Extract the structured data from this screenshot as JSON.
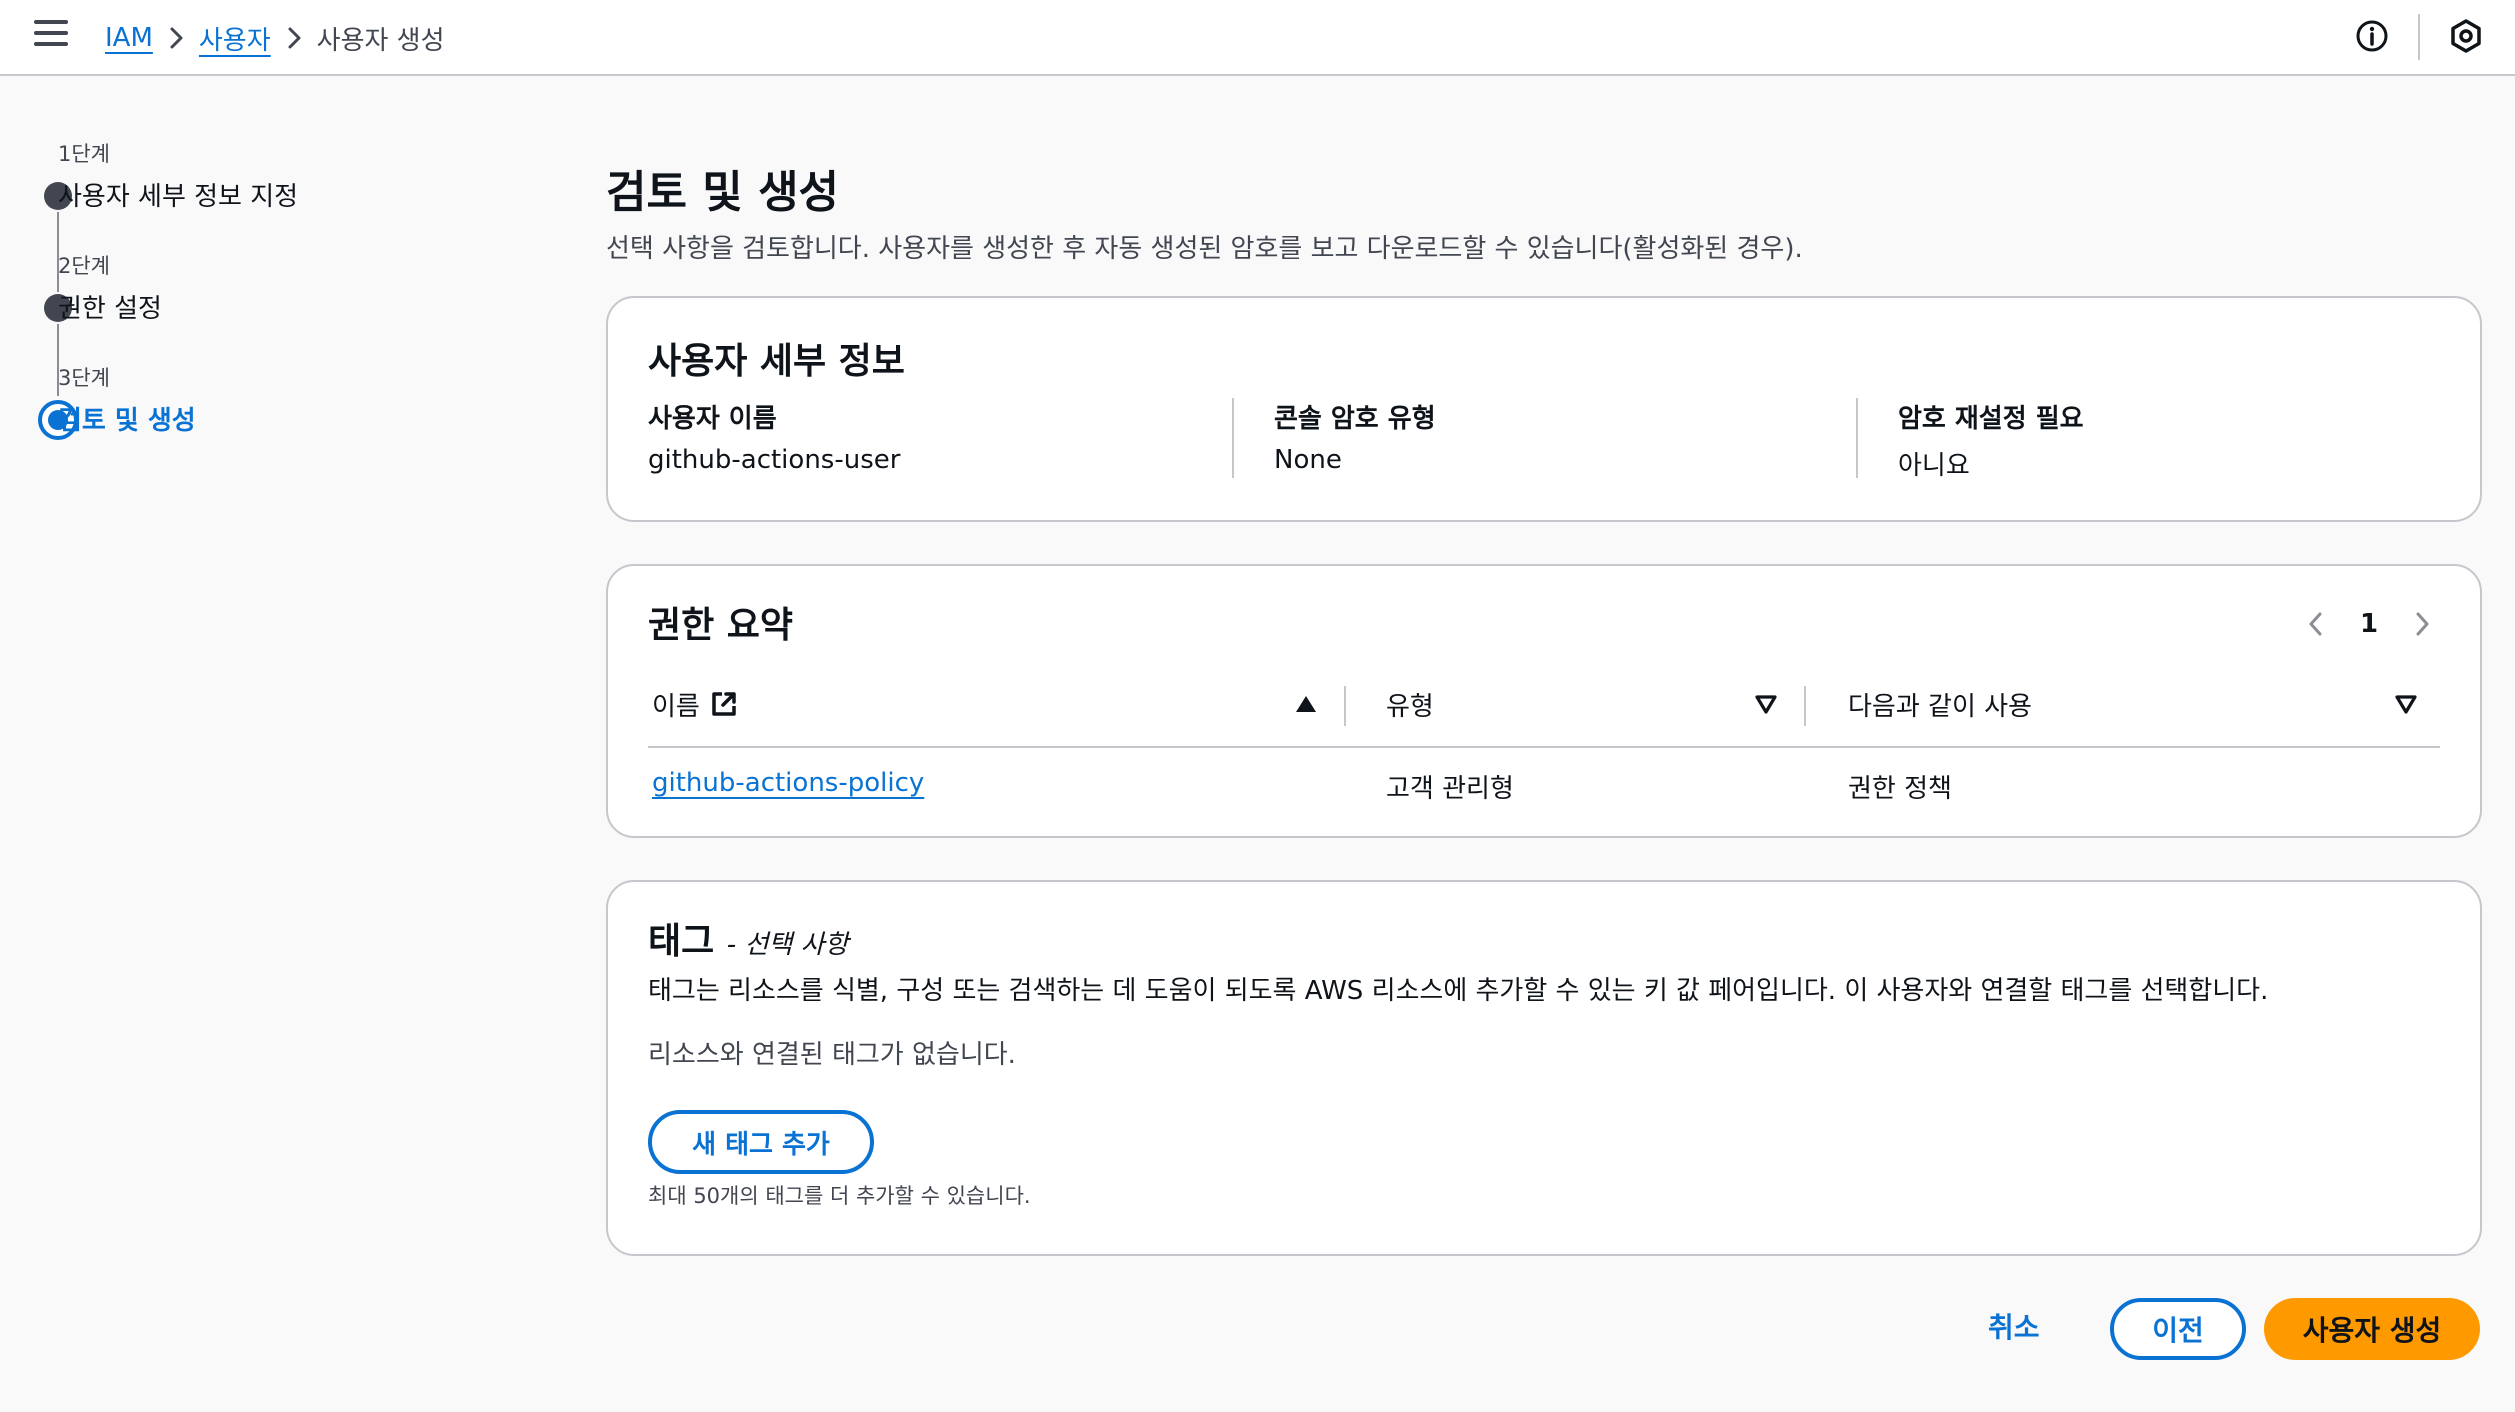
{
  "breadcrumb": {
    "items": [
      {
        "label": "IAM"
      },
      {
        "label": "사용자"
      },
      {
        "label": "사용자 생성"
      }
    ]
  },
  "stepper": {
    "steps": [
      {
        "number": "1단계",
        "label": "사용자 세부 정보 지정"
      },
      {
        "number": "2단계",
        "label": "권한 설정"
      },
      {
        "number": "3단계",
        "label": "검토 및 생성"
      }
    ],
    "active_index": 2
  },
  "page": {
    "title": "검토 및 생성",
    "description": "선택 사항을 검토합니다. 사용자를 생성한 후 자동 생성된 암호를 보고 다운로드할 수 있습니다(활성화된 경우)."
  },
  "user_details": {
    "title": "사용자 세부 정보",
    "fields": [
      {
        "key": "사용자 이름",
        "value": "github-actions-user"
      },
      {
        "key": "콘솔 암호 유형",
        "value": "None"
      },
      {
        "key": "암호 재설정 필요",
        "value": "아니요"
      }
    ]
  },
  "permissions": {
    "title": "권한 요약",
    "page_number": "1",
    "columns": [
      {
        "label": "이름"
      },
      {
        "label": "유형"
      },
      {
        "label": "다음과 같이 사용"
      }
    ],
    "rows": [
      {
        "name": "github-actions-policy",
        "type": "고객 관리형",
        "used_as": "권한 정책"
      }
    ]
  },
  "tags": {
    "title": "태그",
    "optional": "- 선택 사항",
    "description": "태그는 리소스를 식별, 구성 또는 검색하는 데 도움이 되도록 AWS 리소스에 추가할 수 있는 키 값 페어입니다. 이 사용자와 연결할 태그를 선택합니다.",
    "empty": "리소스와 연결된 태그가 없습니다.",
    "add_button": "새 태그 추가",
    "hint": "최대 50개의 태그를 더 추가할 수 있습니다."
  },
  "footer": {
    "cancel": "취소",
    "previous": "이전",
    "create": "사용자 생성"
  },
  "colors": {
    "link": "#0972d3",
    "primary": "#ff9900",
    "text": "#0f141a",
    "secondary_text": "#424650",
    "border": "#c6c6cd"
  },
  "icons": [
    "menu-icon",
    "chevron-right-icon",
    "info-icon",
    "settings-hexagon-icon",
    "external-link-icon",
    "sort-ascending-icon",
    "sort-descending-icon",
    "chevron-left-icon"
  ]
}
